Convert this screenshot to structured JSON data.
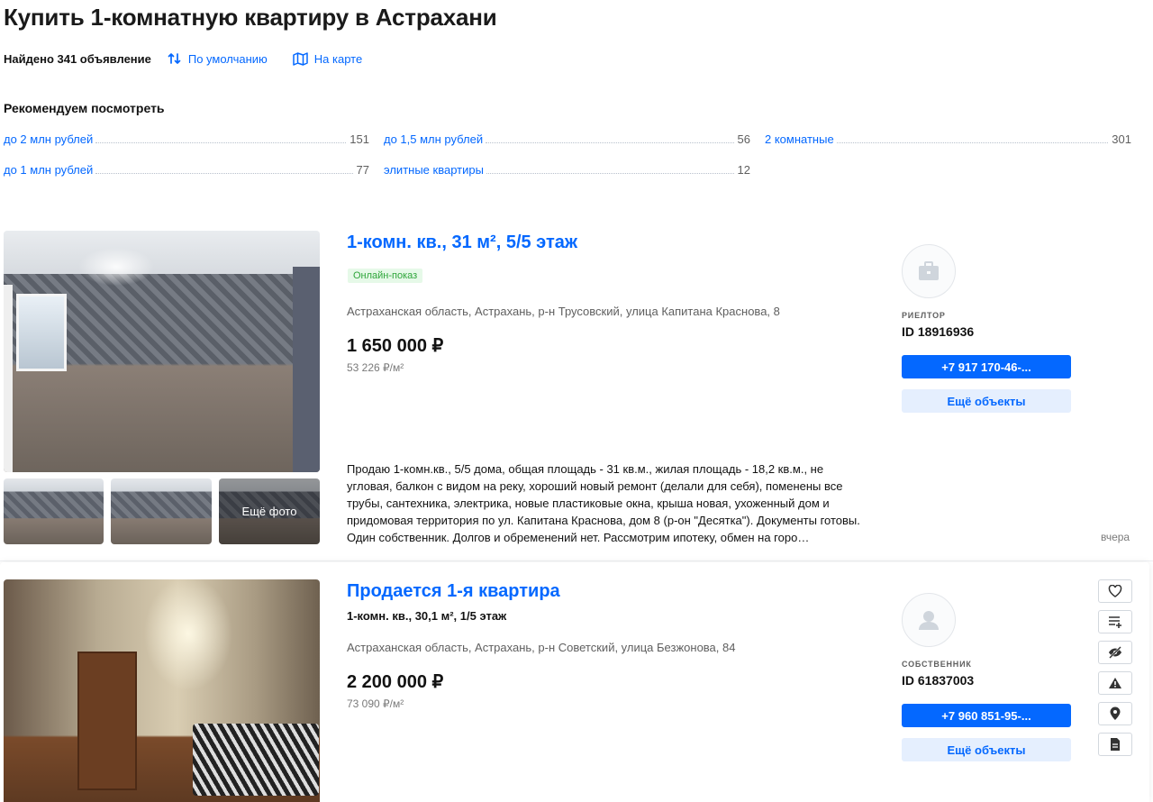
{
  "header": {
    "title": "Купить 1-комнатную квартиру в Астрахани",
    "found": "Найдено 341 объявление",
    "sort_label": "По умолчанию",
    "map_label": "На карте"
  },
  "recommend": {
    "title": "Рекомендуем посмотреть",
    "items": [
      {
        "label": "до 2 млн рублей",
        "count": "151"
      },
      {
        "label": "до 1,5 млн рублей",
        "count": "56"
      },
      {
        "label": "2 комнатные",
        "count": "301"
      },
      {
        "label": "до 1 млн рублей",
        "count": "77"
      },
      {
        "label": "элитные квартиры",
        "count": "12"
      }
    ]
  },
  "listings": [
    {
      "title": "1-комн. кв., 31 м², 5/5 этаж",
      "badge": "Онлайн-показ",
      "address": "Астраханская область, Астрахань, р-н Трусовский, улица Капитана Краснова, 8",
      "price": "1 650 000 ₽",
      "price_per_m2": "53 226 ₽/м²",
      "description": "Продаю 1-комн.кв., 5/5 дома, общая площадь - 31 кв.м., жилая площадь - 18,2 кв.м., не угловая, балкон с видом на реку, хороший новый ремонт (делали для себя), поменены все трубы, сантехника, электрика, новые пластиковые окна, крыша новая, ухоженный дом и придомовая территория по ул. Капитана Краснова, дом 8 (р-он \"Десятка\"). Документы готовы. Один собственник. Долгов и обременений нет. Рассмотрим ипотеку, обмен на горо…",
      "more_photos": "Ещё фото",
      "date": "вчера",
      "agent_role": "РИЕЛТОР",
      "agent_id": "ID 18916936",
      "phone": "+7 917 170-46-...",
      "more_objects": "Ещё объекты",
      "avatar_icon": "briefcase-icon"
    },
    {
      "title": "Продается 1-я квартира",
      "subtitle": "1-комн. кв., 30,1 м², 1/5 этаж",
      "address": "Астраханская область, Астрахань, р-н Советский, улица Безжонова, 84",
      "price": "2 200 000 ₽",
      "price_per_m2": "73 090 ₽/м²",
      "agent_role": "СОБСТВЕННИК",
      "agent_id": "ID 61837003",
      "phone": "+7 960 851-95-...",
      "more_objects": "Ещё объекты",
      "avatar_icon": "user-icon",
      "actions": [
        "favorite-icon",
        "compare-icon",
        "hide-icon",
        "report-icon",
        "location-icon",
        "document-icon"
      ]
    }
  ],
  "colors": {
    "accent": "#0468ff",
    "accent_light": "#e5effe",
    "badge_bg": "#e6f9e8",
    "badge_text": "#2ea53a",
    "muted": "#5f5f5f"
  }
}
